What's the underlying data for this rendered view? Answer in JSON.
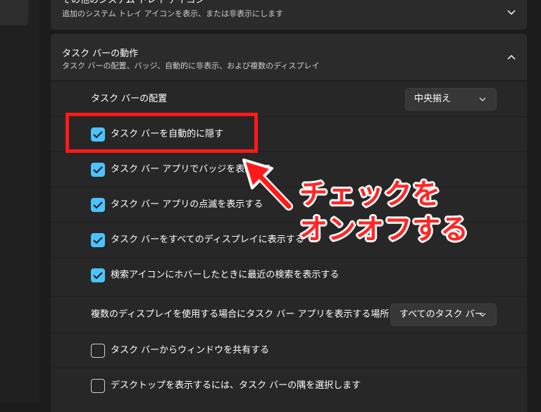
{
  "top_card": {
    "title": "その他のシステム トレイ アイコン",
    "subtitle": "追加のシステム トレイ アイコンを表示、または非表示にします"
  },
  "behavior": {
    "title": "タスク バーの動作",
    "subtitle": "タスク バーの配置、バッジ、自動的に非表示、および複数のディスプレイ"
  },
  "alignment": {
    "label": "タスク バーの配置",
    "value": "中央揃え"
  },
  "options": [
    {
      "label": "タスク バーを自動的に隠す",
      "checked": true
    },
    {
      "label": "タスク バー アプリでバッジを表示する",
      "checked": true
    },
    {
      "label": "タスク バー アプリの点滅を表示する",
      "checked": true
    },
    {
      "label": "タスク バーをすべてのディスプレイに表示する",
      "checked": true
    },
    {
      "label": "検索アイコンにホバーしたときに最近の検索を表示する",
      "checked": true
    }
  ],
  "multi_display": {
    "label": "複数のディスプレイを使用する場合にタスク バー アプリを表示する場所",
    "value": "すべてのタスク バー"
  },
  "options2": [
    {
      "label": "タスク バーからウィンドウを共有する",
      "checked": false
    },
    {
      "label": "デスクトップを表示するには、タスク バーの隅を選択します",
      "checked": false
    }
  ],
  "annotation": {
    "line1": "チェックを",
    "line2": "オンオフする"
  },
  "colors": {
    "accent": "#4cc2ff",
    "highlight": "#ff1a1a",
    "background": "#1c1c1c",
    "card": "#2b2b2b"
  }
}
